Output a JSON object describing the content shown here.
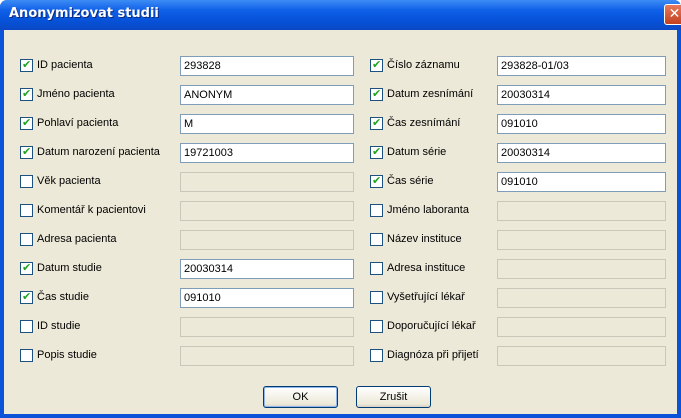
{
  "window": {
    "title": "Anonymizovat studii",
    "close_icon": "close-icon"
  },
  "left_rows": [
    {
      "label": "ID pacienta",
      "checked": true,
      "value": "293828"
    },
    {
      "label": "Jméno pacienta",
      "checked": true,
      "value": "ANONYM"
    },
    {
      "label": "Pohlaví pacienta",
      "checked": true,
      "value": "M"
    },
    {
      "label": "Datum narození pacienta",
      "checked": true,
      "value": "19721003"
    },
    {
      "label": "Věk pacienta",
      "checked": false,
      "value": ""
    },
    {
      "label": "Komentář k pacientovi",
      "checked": false,
      "value": ""
    },
    {
      "label": "Adresa pacienta",
      "checked": false,
      "value": ""
    },
    {
      "label": "Datum studie",
      "checked": true,
      "value": "20030314"
    },
    {
      "label": "Čas studie",
      "checked": true,
      "value": "091010"
    },
    {
      "label": "ID studie",
      "checked": false,
      "value": ""
    },
    {
      "label": "Popis studie",
      "checked": false,
      "value": ""
    }
  ],
  "right_rows": [
    {
      "label": "Číslo záznamu",
      "checked": true,
      "value": "293828-01/03"
    },
    {
      "label": "Datum zesnímání",
      "checked": true,
      "value": "20030314"
    },
    {
      "label": "Čas zesnímání",
      "checked": true,
      "value": "091010"
    },
    {
      "label": "Datum série",
      "checked": true,
      "value": "20030314"
    },
    {
      "label": "Čas série",
      "checked": true,
      "value": "091010"
    },
    {
      "label": "Jméno laboranta",
      "checked": false,
      "value": ""
    },
    {
      "label": "Název instituce",
      "checked": false,
      "value": ""
    },
    {
      "label": "Adresa instituce",
      "checked": false,
      "value": ""
    },
    {
      "label": "Vyšetřující lékař",
      "checked": false,
      "value": ""
    },
    {
      "label": "Doporučující lékař",
      "checked": false,
      "value": ""
    },
    {
      "label": "Diagnóza při přijetí",
      "checked": false,
      "value": ""
    }
  ],
  "buttons": {
    "ok": "OK",
    "cancel": "Zrušit"
  }
}
